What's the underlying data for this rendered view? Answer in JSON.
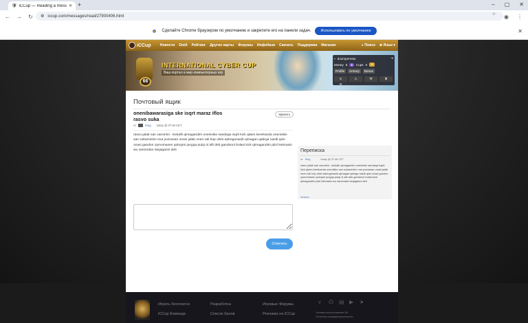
{
  "browser": {
    "tab_title": "iCCup — Reading a message f...",
    "url": "iccup.com/messages/read/27900406.html",
    "infobar_text": "Сделайте Chrome браузером по умолчанию и закрепите его на панели задач.",
    "infobar_button": "Использовать по умолчанию"
  },
  "site": {
    "logo": "iCCup",
    "menu": [
      "Новости",
      "DotA",
      "Рейтинг",
      "Другие карты",
      "Форумы",
      "Инфобаза",
      "Скачать",
      "Поддержка",
      "Магазин"
    ],
    "search": "Поиск",
    "lang": "Язык"
  },
  "banner": {
    "title": "INTERNATIONAL CYBER CUP",
    "subtitle": "Ваш портал в мир компьютерных игр",
    "level": "66"
  },
  "user_panel": {
    "username": "doomperesto",
    "money_label": "Money",
    "money": "8",
    "cups_label": "Cups",
    "cups": "0",
    "profile": "Profile",
    "armory": "Armory",
    "bonus": "Bonus",
    "count": "5"
  },
  "page": {
    "title": "Почтовый ящик",
    "subject_line1": "onenibawarasiga ske isqrt maraz iflos",
    "subject_line2": "rasvo suka",
    "delete": "Удалить",
    "author_prefix": "от",
    "author": "King",
    "date": "today @ 07:48 CET",
    "body": "rasvo jalab san xaromini - kickafk qimagandim onenisike sandaqa isqrti kick qiwim kerekanda onenisike san sokaminiim mut yozzasan onasi jalab onen rak bop olsin adenganasib qimagan qabrga nasib qsin onasi gandon oymomasen qotoqmi jungqa pulqi ol afk deb gandonni bolasi kick qimagandim ptizi ketmasin wu xaromdan tanjaganni deb",
    "reply": "Ответить"
  },
  "sidebar": {
    "title": "Переписка",
    "author_prefix": "от",
    "author": "King",
    "date": "today @ 07:48 CET",
    "preview": "rasvo jalab san xaromini - kickafk qimagandim onenisike sandaqa isqrti kick qiwim kerekanda onenisike san sokaminiim mut yozzasan onasi jalab onen rak bop olsin adenganasib qimagan qabrga nasib qsin onasi gandon oymomasen qotoqmi jungqa pulqi ol afk deb gandonni bolasi kick qimagandim ptizi ketmasin wu xaromdan tanjaganni deb",
    "more": "читать..."
  },
  "footer": {
    "col1": [
      "Играть бесплатно",
      "iCCup Команда"
    ],
    "col2": [
      "Разработка",
      "Список банов"
    ],
    "col3": [
      "Игровые Форумы",
      "Реклама на iCCup"
    ],
    "legal": [
      "Условия использования 18+",
      "Политика конфиденциальности"
    ]
  },
  "colors": {
    "menu_gold": "#b48427",
    "reply_blue": "#4a9ee8",
    "default_btn": "#1a56c4"
  }
}
